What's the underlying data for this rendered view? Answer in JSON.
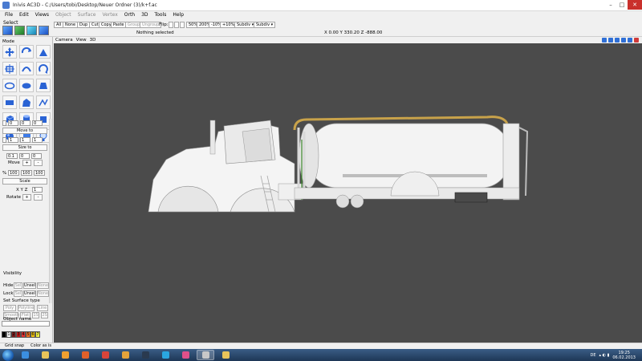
{
  "window": {
    "title": "Inivis AC3D - C:/Users/tobi/Desktop/Neuer Ordner (3)/k+f.ac",
    "controls": [
      "–",
      "□",
      "✕"
    ]
  },
  "menu": [
    {
      "label": "File",
      "disabled": false
    },
    {
      "label": "Edit",
      "disabled": false
    },
    {
      "label": "Views",
      "disabled": false
    },
    {
      "label": "Object",
      "disabled": true
    },
    {
      "label": "Surface",
      "disabled": true
    },
    {
      "label": "Vertex",
      "disabled": true
    },
    {
      "label": "Orth",
      "disabled": false
    },
    {
      "label": "3D",
      "disabled": false
    },
    {
      "label": "Tools",
      "disabled": false
    },
    {
      "label": "Help",
      "disabled": false
    }
  ],
  "toolbar": {
    "select_label": "Select",
    "all": "All",
    "none": "None",
    "dup": "Dup",
    "cut": "Cut",
    "copy": "Copy",
    "paste": "Paste",
    "group": "Group",
    "ungroup": "Ungroup",
    "flip_label": "Flip:",
    "zoom_50": "50%",
    "zoom_200": "200%",
    "minus10": "-10%",
    "plus10": "+10%",
    "subdiv1": "Subdiv",
    "subdiv2": "Subdiv",
    "status": "Nothing selected",
    "coords": "X 0.00 Y 330.20 Z -888.00"
  },
  "panel": {
    "mode_label": "Mode",
    "move_values": [
      "0",
      "0",
      "0"
    ],
    "move_to": "Move to",
    "size_values": [
      "1",
      "1",
      "1"
    ],
    "size_to": "Size to",
    "move_step": [
      "0.1",
      "0",
      "0"
    ],
    "move_label": "Move",
    "scale_values": [
      "100",
      "100",
      "100"
    ],
    "scale_pct": "%",
    "scale": "Scale",
    "axes": "X Y Z",
    "rotate_value": "1",
    "rotate_label": "Rotate",
    "plus": "+",
    "minus": "-",
    "visibility": "Visibility",
    "hide": "Hide:",
    "lock": "Lock:",
    "sel": "Sel",
    "unsel": "Unsel",
    "none": "None",
    "surface_type": "Set Surface type",
    "poly": "Poly",
    "polyline": "Polyline",
    "line": "Line",
    "smooth": "Smooth",
    "flat": "Flat",
    "s1": "1S",
    "s2": "2S",
    "object_name": "Object name",
    "palette": [
      "#000000",
      "#ffffff",
      "#7a1a1a",
      "#c01818",
      "#e03030",
      "#f07020",
      "#f0c010",
      "#f0f040"
    ],
    "palette_labels": [
      "",
      "1",
      "2",
      "3",
      "4",
      "5",
      "6",
      "7"
    ]
  },
  "viewport": {
    "menu": [
      "Camera",
      "View",
      "3D"
    ],
    "background": "#4b4b4b"
  },
  "bottom": {
    "items": [
      "Grid snap",
      "Color as is"
    ]
  },
  "taskbar": {
    "locale": "DE",
    "time": "19:25",
    "date": "06.02.2013"
  }
}
